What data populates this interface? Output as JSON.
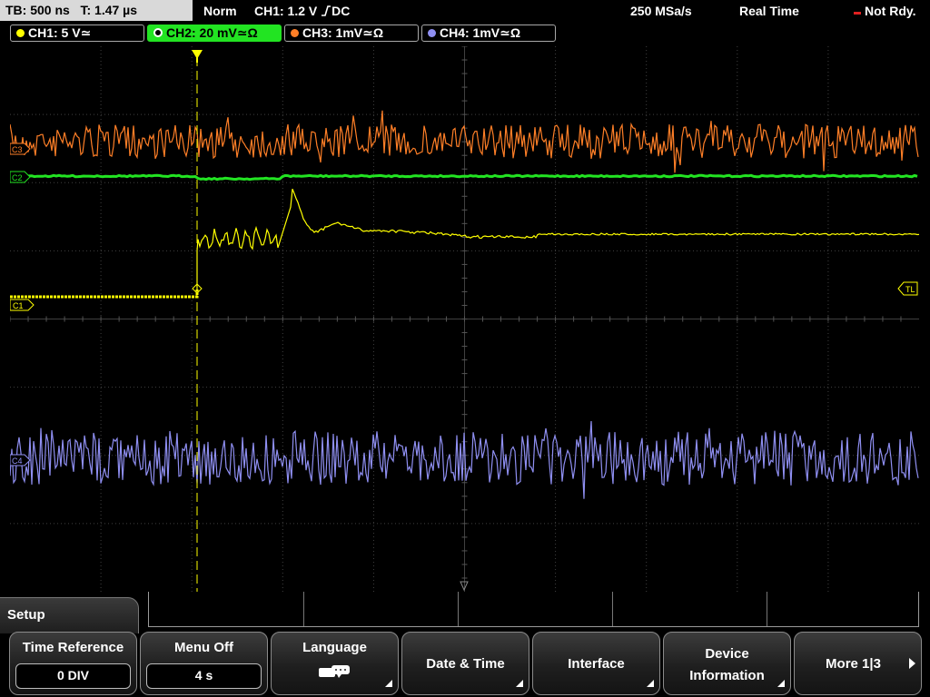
{
  "status_bar": {
    "timebase": "TB: 500 ns",
    "trigger_time": "T: 1.47 µs",
    "mode": "Norm",
    "trigger_info": "CH1: 1.2 V",
    "trigger_coupling": "DC",
    "sample_rate": "250 MSa/s",
    "acq_mode": "Real Time",
    "status": "Not Rdy."
  },
  "channels": [
    {
      "label": "CH1: 5 V",
      "suffix": "≃",
      "color": "#ffff00",
      "active": false
    },
    {
      "label": "CH2: 20 mV",
      "suffix": "≃Ω",
      "color": "#22e422",
      "active": true
    },
    {
      "label": "CH3: 1mV",
      "suffix": "≃Ω",
      "color": "#ff7f27",
      "active": false
    },
    {
      "label": "CH4: 1mV",
      "suffix": "≃Ω",
      "color": "#8f8ff2",
      "active": false
    }
  ],
  "markers": {
    "c1": "C1",
    "c2": "C2",
    "c3": "C3",
    "c4": "C4",
    "trigger_level": "TL"
  },
  "trace_colors": {
    "ch1": "#ffff00",
    "ch2": "#22e422",
    "ch3": "#ff7f27",
    "ch4": "#8f8ff2",
    "trigger": "#ffff00",
    "grid": "#404040"
  },
  "menu": {
    "title": "Setup",
    "softkeys": [
      {
        "label": "Time Reference",
        "value": "0 DIV"
      },
      {
        "label": "Menu Off",
        "value": "4 s"
      },
      {
        "label": "Language",
        "icon": "keyboard-icon"
      },
      {
        "label": "Date & Time"
      },
      {
        "label": "Interface"
      },
      {
        "label_line1": "Device",
        "label_line2": "Information"
      },
      {
        "label": "More 1|3"
      }
    ]
  }
}
